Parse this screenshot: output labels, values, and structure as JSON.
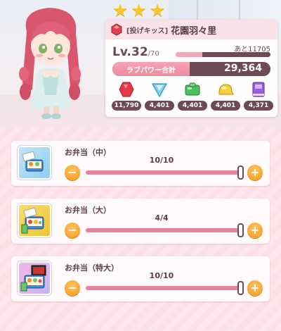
{
  "character": {
    "stars": [
      "★",
      "★",
      "★"
    ],
    "name_tag": "[投げキッス]",
    "name": "花園羽々里",
    "level_prefix": "Lv.",
    "level": "32",
    "level_max": "/70",
    "remaining_exp": "あと11705",
    "exp_progress": 0.28,
    "love_power_label": "ラブパワー合計",
    "love_power_value": "29,364",
    "items": [
      {
        "icon": "red-gem-icon",
        "count": "11,790"
      },
      {
        "icon": "blue-triangle-icon",
        "count": "4,401"
      },
      {
        "icon": "green-box-icon",
        "count": "4,401"
      },
      {
        "icon": "yellow-cap-icon",
        "count": "4,401"
      },
      {
        "icon": "purple-book-icon",
        "count": "4,371"
      }
    ]
  },
  "bento_rows": [
    {
      "title": "お弁当（中）",
      "quantity": "10/10",
      "fraction": 1.0,
      "icon": "bento-medium-icon"
    },
    {
      "title": "お弁当（大）",
      "quantity": "4/4",
      "fraction": 1.0,
      "icon": "bento-large-icon"
    },
    {
      "title": "お弁当（特大）",
      "quantity": "10/10",
      "fraction": 1.0,
      "icon": "bento-xl-icon"
    }
  ],
  "controls": {
    "minus": "−",
    "plus": "+"
  },
  "colors": {
    "accent_pink": "#e9829a",
    "button_orange": "#f49a20",
    "dark_plum": "#6d4a55"
  }
}
